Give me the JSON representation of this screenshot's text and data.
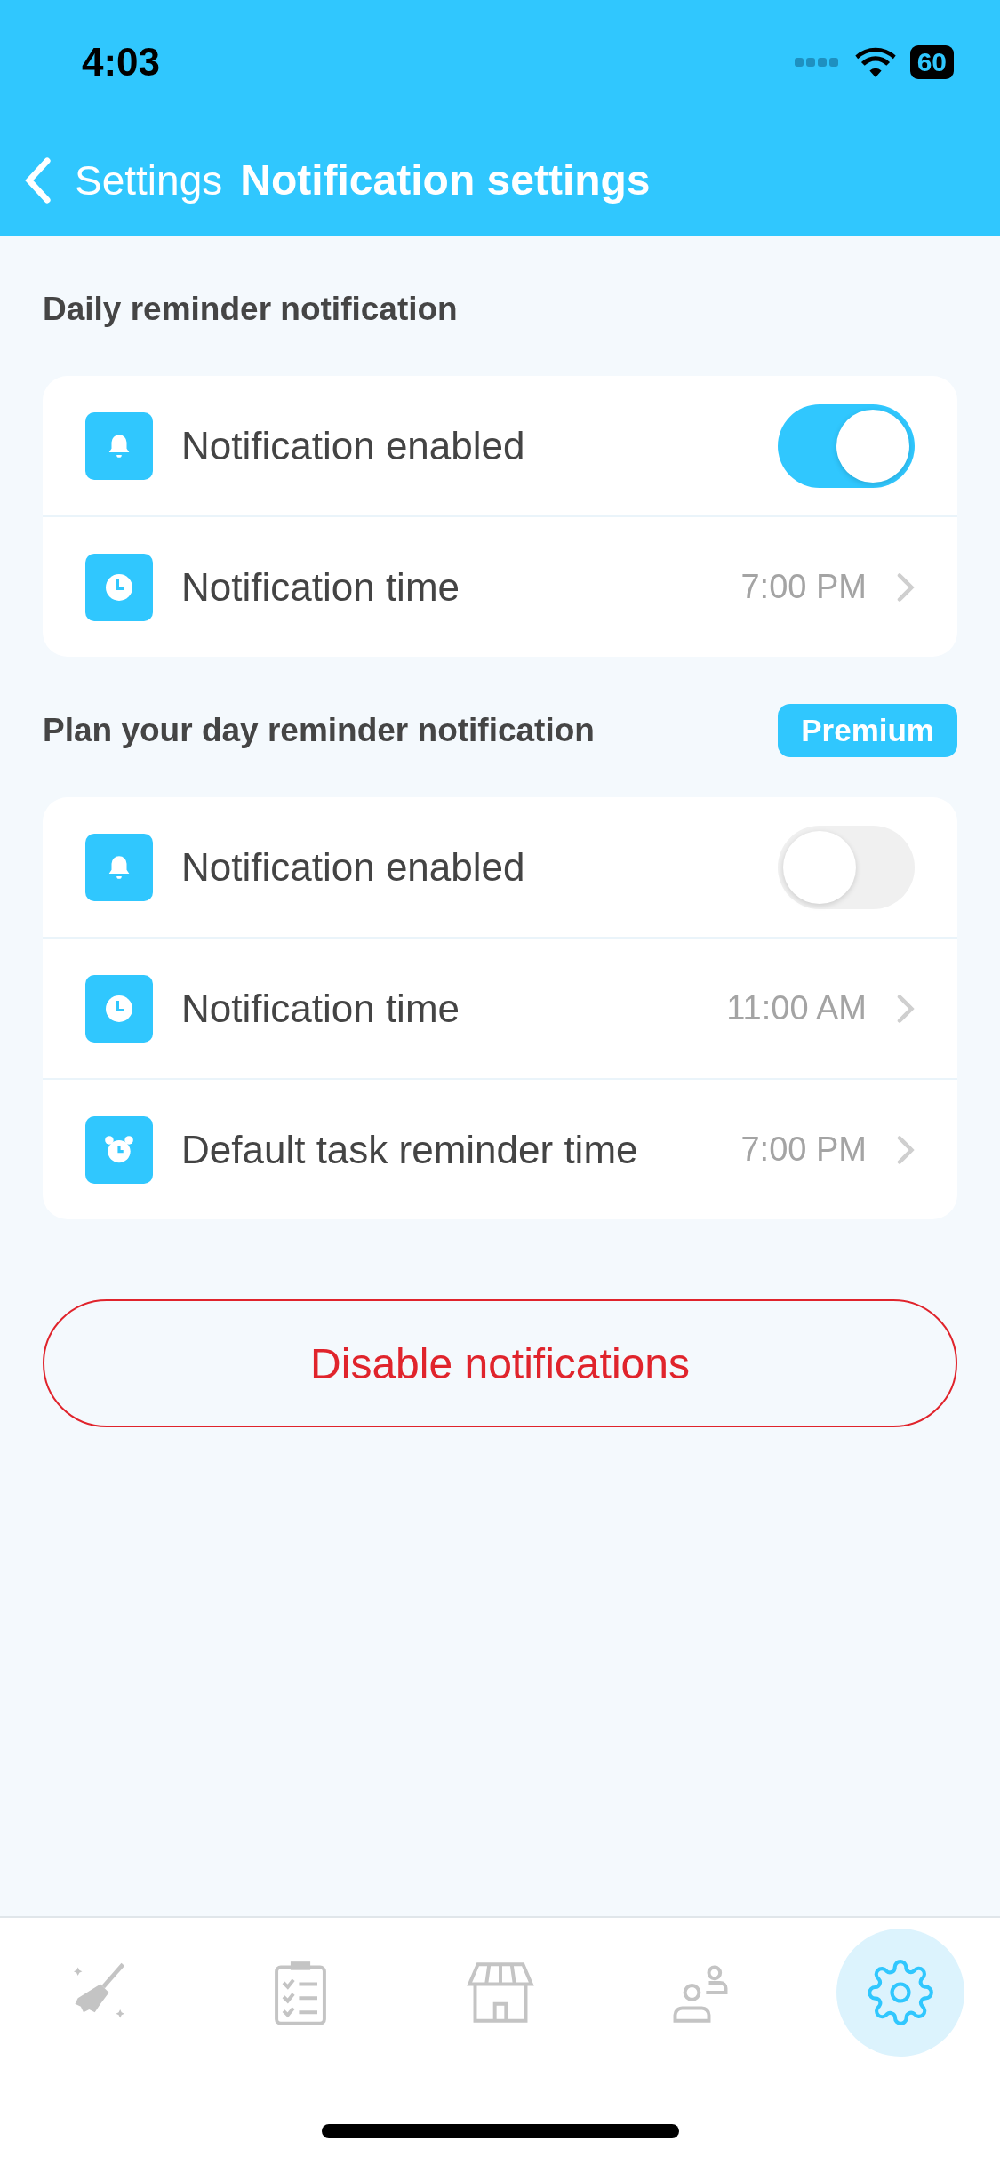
{
  "status_bar": {
    "time": "4:03",
    "battery": "60"
  },
  "nav": {
    "back_label": "Settings",
    "title": "Notification settings"
  },
  "sections": [
    {
      "title": "Daily reminder notification",
      "rows": [
        {
          "kind": "toggle",
          "label": "Notification enabled",
          "on": true
        },
        {
          "kind": "time",
          "label": "Notification time",
          "value": "7:00 PM"
        }
      ]
    },
    {
      "title": "Plan your day reminder notification",
      "badge": "Premium",
      "rows": [
        {
          "kind": "toggle",
          "label": "Notification enabled",
          "on": false
        },
        {
          "kind": "time",
          "label": "Notification time",
          "value": "11:00 AM"
        },
        {
          "kind": "alarm",
          "label": "Default task reminder time",
          "value": "7:00 PM"
        }
      ]
    }
  ],
  "disable_button": "Disable notifications",
  "tabs": [
    {
      "selected": false
    },
    {
      "selected": false
    },
    {
      "selected": false
    },
    {
      "selected": false
    },
    {
      "selected": true
    }
  ]
}
